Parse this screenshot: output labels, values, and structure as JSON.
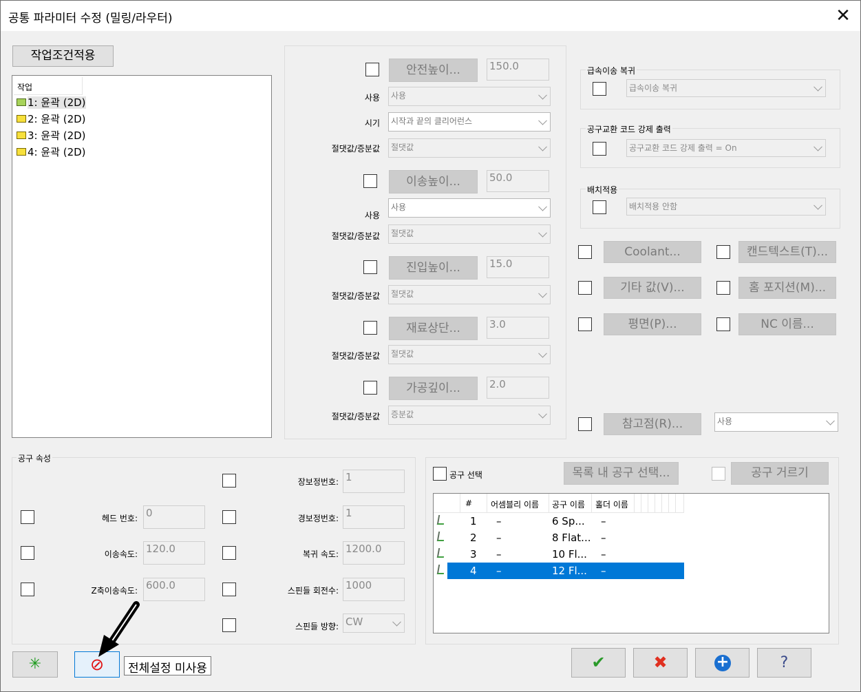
{
  "window": {
    "title": "공통 파라미터 수정 (밀링/라우터)",
    "close_glyph": "✕"
  },
  "left": {
    "apply_button": "작업조건적용",
    "tree_header": "작업",
    "ops": [
      "1: 윤곽 (2D)",
      "2: 윤곽 (2D)",
      "3: 윤곽 (2D)",
      "4: 윤곽 (2D)"
    ]
  },
  "heights": {
    "clearance_btn": "안전높이...",
    "clearance_val": "150.0",
    "use_label": "사용",
    "use_value": "사용",
    "timing_label": "시기",
    "timing_value": "시작과 끝의 클리어런스",
    "absinc_label": "절댓값/증분값",
    "abs_value": "절댓값",
    "inc_value": "증분값",
    "retract_btn": "이송높이...",
    "retract_val": "50.0",
    "use2_value": "사용",
    "feed_btn": "진입높이...",
    "feed_val": "15.0",
    "top_btn": "재료상단...",
    "top_val": "3.0",
    "depth_btn": "가공깊이...",
    "depth_val": "2.0"
  },
  "right": {
    "rapid_group": "급속이송 복귀",
    "rapid_value": "급속이송 복귀",
    "toolchange_group": "공구교환 코드 강제 출력",
    "toolchange_value": "공구교환 코드 강제 출력 = On",
    "batch_group": "배치적용",
    "batch_value": "배치적용 안함",
    "coolant_btn": "Coolant...",
    "canned_btn": "캔드텍스트(T)...",
    "misc_btn": "기타 값(V)...",
    "home_btn": "홈 포지션(M)...",
    "plane_btn": "평면(P)...",
    "nc_btn": "NC 이름...",
    "ref_btn": "참고점(R)...",
    "ref_value": "사용"
  },
  "tool_props": {
    "group": "공구 속성",
    "head_label": "헤드 번호:",
    "head_val": "0",
    "feed_label": "이송속도:",
    "feed_val": "120.0",
    "zfeed_label": "Z축이송속도:",
    "zfeed_val": "600.0",
    "len_label": "장보정번호:",
    "len_val": "1",
    "dia_label": "경보정번호:",
    "dia_val": "1",
    "ret_label": "복귀 속도:",
    "ret_val": "1200.0",
    "rpm_label": "스핀들 회전수:",
    "rpm_val": "1000",
    "dir_label": "스핀들 방향:",
    "dir_val": "CW"
  },
  "tool_select": {
    "checkbox_label": "공구 선택",
    "list_btn": "목록 내 공구 선택...",
    "filter_btn": "공구 거르기",
    "columns": [
      "#",
      "어셈블리 이름",
      "공구 이름",
      "홀더 이름"
    ],
    "rows": [
      {
        "num": "1",
        "assembly": "–",
        "tool": "6 Sp...",
        "holder": "–"
      },
      {
        "num": "2",
        "assembly": "–",
        "tool": "8 Flat...",
        "holder": "–"
      },
      {
        "num": "3",
        "assembly": "–",
        "tool": "10 Fl...",
        "holder": "–"
      },
      {
        "num": "4",
        "assembly": "–",
        "tool": "12 Fl...",
        "holder": "–"
      }
    ]
  },
  "bottom": {
    "star_glyph": "✳",
    "disable_glyph": "⊘",
    "disable_all_label": "전체설정 미사용",
    "ok_glyph": "✔",
    "cancel_glyph": "✖",
    "add_glyph": "+",
    "help_glyph": "?"
  },
  "colors": {
    "selection": "#0078d7",
    "ok": "#2a9a2a",
    "cancel": "#e03020",
    "add": "#1a6fd0"
  }
}
